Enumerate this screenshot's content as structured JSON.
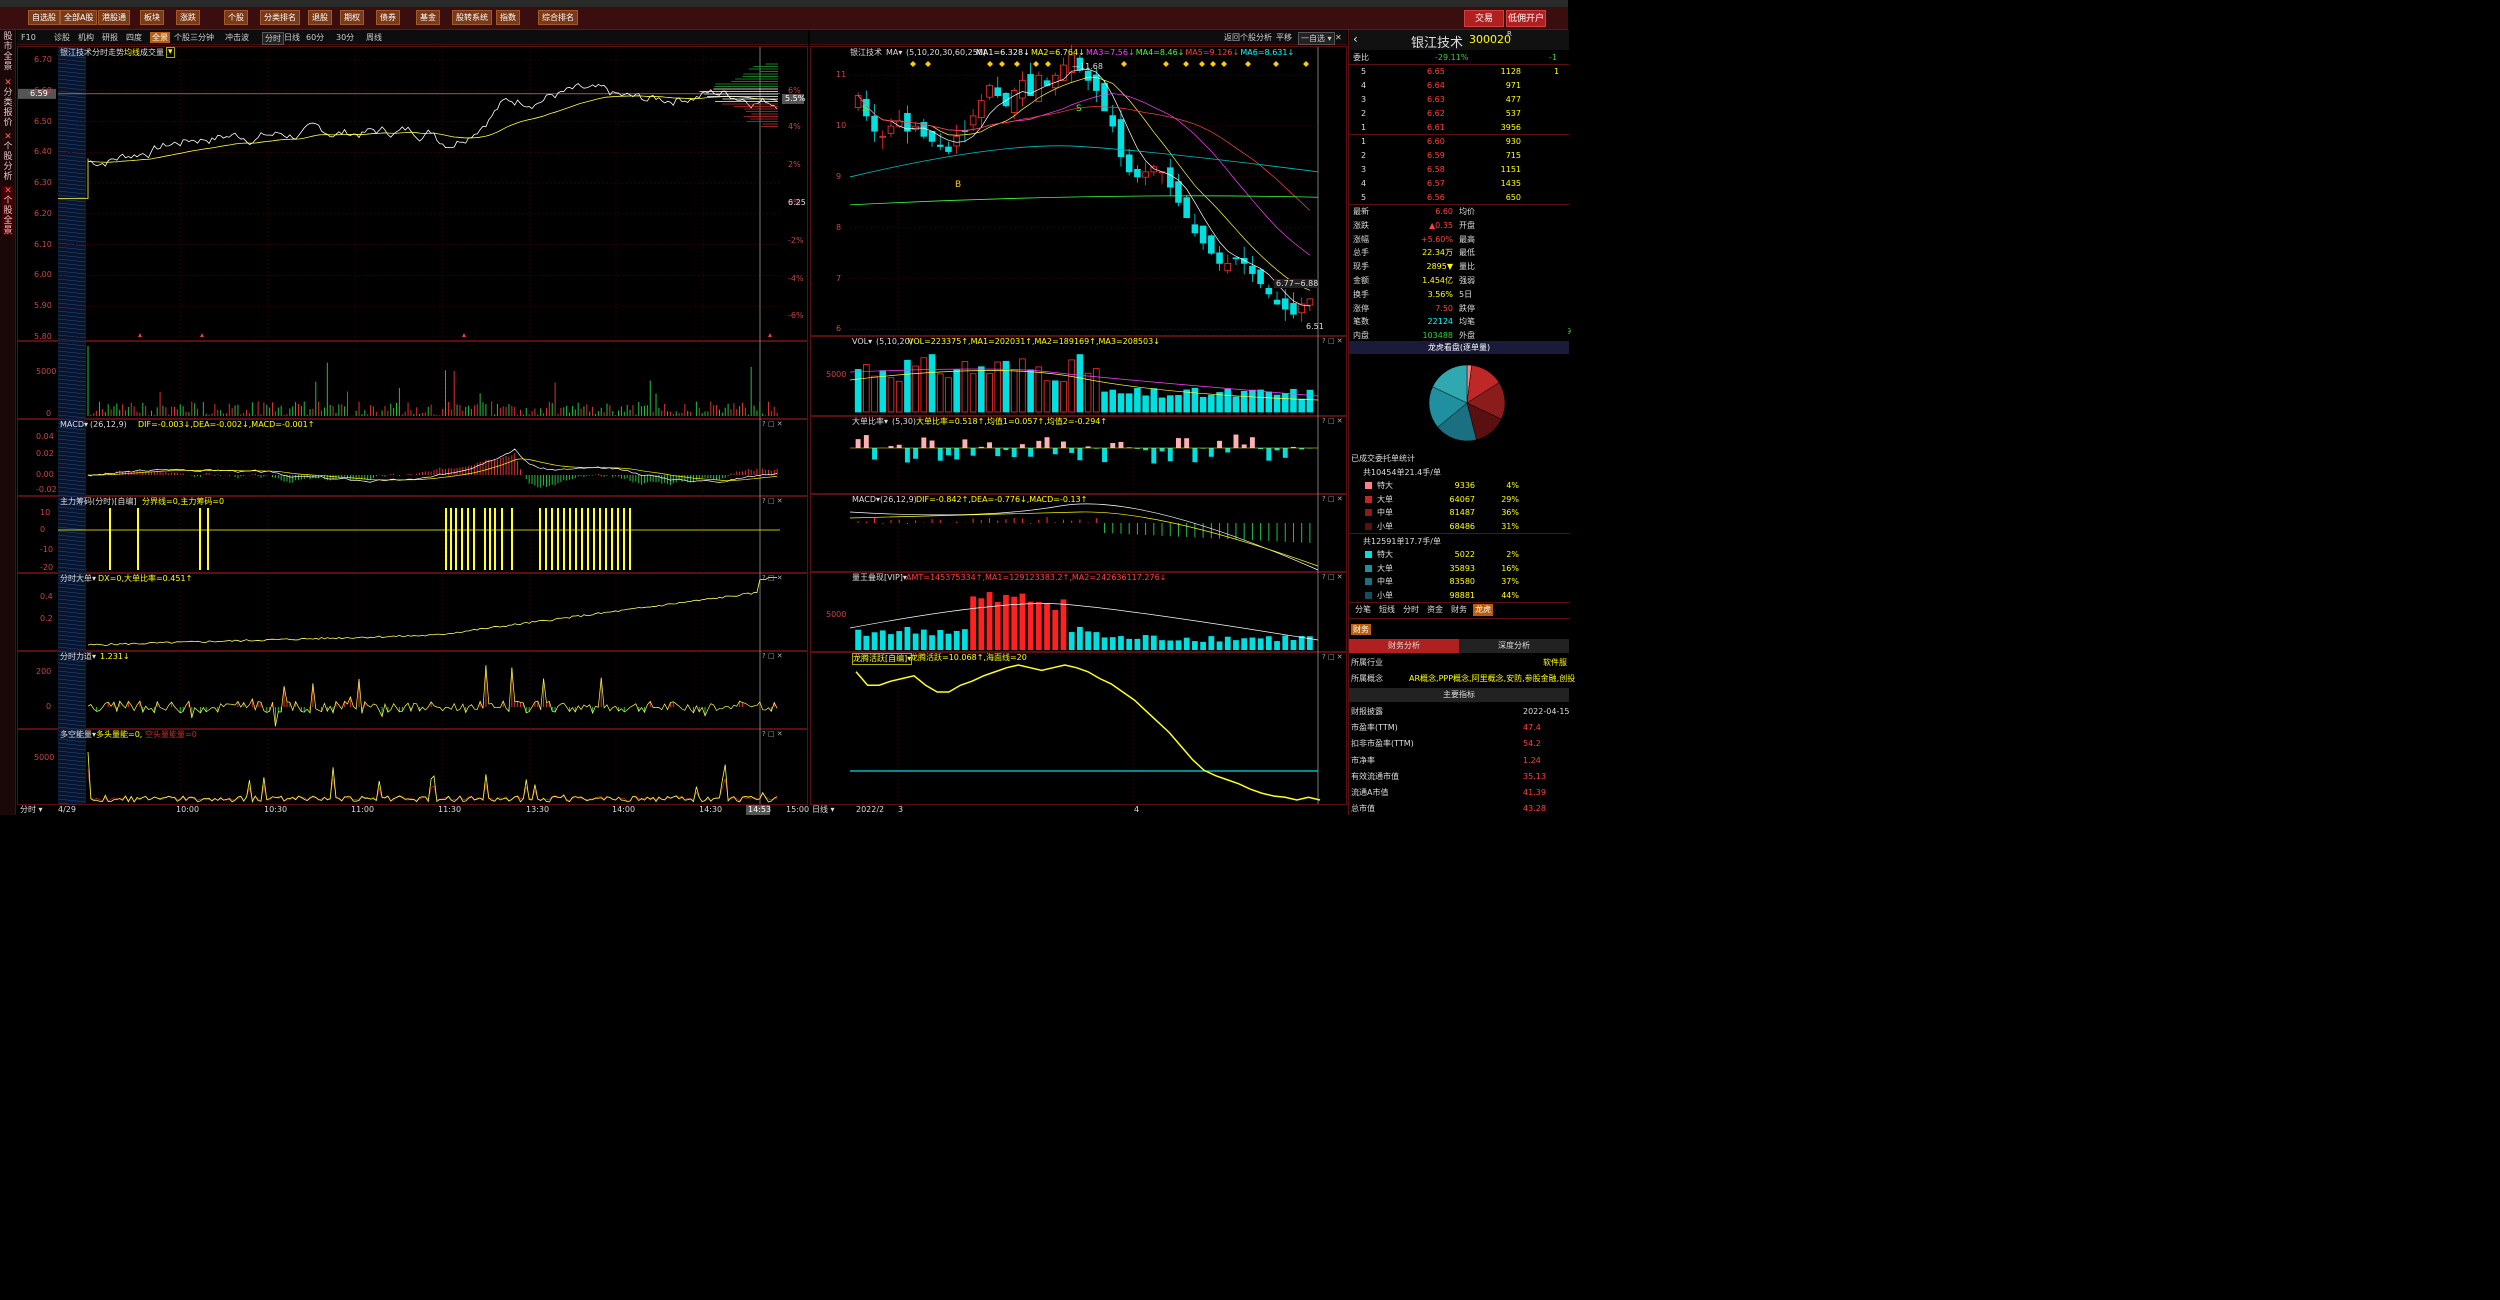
{
  "menu": {
    "items": [
      "自选股",
      "全部A股",
      "港股通",
      "板块",
      "涨跌",
      "个股",
      "分类排名",
      "退股",
      "期权",
      "债券",
      "基金",
      "股转系统",
      "指数",
      "综合排名"
    ],
    "trade_btn": "交易",
    "open_btn": "低佣开户"
  },
  "left_nav": [
    "股市全景",
    "分类报价",
    "个股分析",
    "个股全景"
  ],
  "left_toolbar": {
    "items": [
      "F10",
      "诊股",
      "机构",
      "研报",
      "四度",
      "全景",
      "个股三分钟",
      "冲击波"
    ],
    "modes": [
      "分时",
      "日线",
      "60分",
      "30分",
      "周线"
    ]
  },
  "right_toolbar": {
    "back": "返回个股分析",
    "flat": "平移",
    "zixuan": "一自选"
  },
  "intraday": {
    "title": "银江技术",
    "sub": "分时走势",
    "avg_label": "均线",
    "vol_label": "成交量",
    "price_ticks": [
      "6.70",
      "6.60",
      "6.59",
      "6.50",
      "6.40",
      "6.30",
      "6.20",
      "6.10",
      "6.00",
      "5.90",
      "5.80"
    ],
    "pct_ticks": [
      "6%",
      "5.5%",
      "4%",
      "2%",
      "0%",
      "-2%",
      "-4%",
      "-6%"
    ],
    "mid_label": "6.25",
    "vol_tick": "5000",
    "vol_zero": "0",
    "macd_title": "MACD",
    "macd_params": "(26,12,9)",
    "macd_vals": "DIF=-0.003↓,DEA=-0.002↓,MACD=-0.001↑",
    "macd_ticks": [
      "0.04",
      "0.02",
      "0.00",
      "-0.02"
    ],
    "zlcm_title": "主力筹码(分时)[自编]",
    "zlcm_vals": "分界线=0,主力筹码=0",
    "zlcm_ticks": [
      "10",
      "0",
      "-10",
      "-20"
    ],
    "fsdd_title": "分时大单",
    "fsdd_vals": "DX=0,大单比率=0.451↑",
    "fsdd_ticks": [
      "0.4",
      "0.2"
    ],
    "fsld_title": "分时力道",
    "fsld_vals": "1.231↓",
    "fsld_ticks": [
      "200",
      "0"
    ],
    "dkn_title": "多空能量",
    "dkn_vals": "多头量能=0,",
    "dkn_red": "空头量能量=0",
    "dkn_ticks": [
      "5000"
    ],
    "time_ticks": [
      "4/29",
      "10:00",
      "10:30",
      "11:00",
      "11:30",
      "13:30",
      "14:00",
      "14:30",
      "14:53",
      "15:00"
    ],
    "corner": "分时"
  },
  "daily": {
    "title": "银江技术",
    "ma_label": "MA",
    "ma_params": "(5,10,20,30,60,250)",
    "ma_vals": [
      {
        "t": "MA1=6.328↓",
        "c": "#ffffff"
      },
      {
        "t": "MA2=6.764↓",
        "c": "#ffff00"
      },
      {
        "t": "MA3=7.56↓",
        "c": "#ff40ff"
      },
      {
        "t": "MA4=8.46↓",
        "c": "#40ff40"
      },
      {
        "t": "MA5=9.126↓",
        "c": "#ff4040"
      },
      {
        "t": "MA6=8.631↓",
        "c": "#00ffff"
      }
    ],
    "price_ticks": [
      "11",
      "10",
      "9",
      "8",
      "7",
      "6"
    ],
    "hi_label": "11.68",
    "lo_label": "6.51",
    "range_label": "6.77~6.88",
    "vol_title": "VOL",
    "vol_params": "(5,10,20)",
    "vol_vals": "VOL=223375↑,MA1=202031↑,MA2=189169↑,MA3=208503↓",
    "vol_tick": "5000",
    "ddbl_title": "大单比率",
    "ddbl_params": "(5,30)",
    "ddbl_vals": "大单比率=0.518↑,均值1=0.057↑,均值2=-0.294↑",
    "macd_title": "MACD",
    "macd_params": "(26,12,9)",
    "macd_vals": "DIF=-0.842↑,DEA=-0.776↓,MACD=-0.13↑",
    "amt_title": "量王叠现[VIP]",
    "amt_vals": "AMT=145375334↑,MA1=129123383.2↑,MA2=242636117.276↓",
    "amt_tick": "5000",
    "lthy_title": "龙腾活跃[自编]",
    "lthy_vals": "龙腾活跃=10.068↑,海面线=20",
    "date_ticks": [
      "2022/2",
      "3",
      "4"
    ],
    "corner": "日线"
  },
  "quote": {
    "name": "银江技术",
    "code": "300020",
    "suffix": "R",
    "weibi_label": "委比",
    "weibi": "-29.11%",
    "weibi_num": "-1",
    "sell": [
      {
        "n": "5",
        "p": "6.65",
        "v": "1128",
        "x": "1"
      },
      {
        "n": "4",
        "p": "6.64",
        "v": "971",
        "x": ""
      },
      {
        "n": "3",
        "p": "6.63",
        "v": "477",
        "x": ""
      },
      {
        "n": "2",
        "p": "6.62",
        "v": "537",
        "x": ""
      },
      {
        "n": "1",
        "p": "6.61",
        "v": "3956",
        "x": ""
      }
    ],
    "buy": [
      {
        "n": "1",
        "p": "6.60",
        "v": "930",
        "x": ""
      },
      {
        "n": "2",
        "p": "6.59",
        "v": "715",
        "x": ""
      },
      {
        "n": "3",
        "p": "6.58",
        "v": "1151",
        "x": ""
      },
      {
        "n": "4",
        "p": "6.57",
        "v": "1435",
        "x": ""
      },
      {
        "n": "5",
        "p": "6.56",
        "v": "650",
        "x": ""
      }
    ],
    "sell_side": [
      "委",
      "卖",
      "单"
    ],
    "buy_side": [
      "委",
      "买",
      "单"
    ],
    "stats": [
      {
        "l": "最新",
        "v": "6.60",
        "l2": "均价",
        "c": "red"
      },
      {
        "l": "涨跌",
        "v": "▲0.35",
        "l2": "开盘",
        "c": "red"
      },
      {
        "l": "涨幅",
        "v": "+5.60%",
        "l2": "最高",
        "c": "red"
      },
      {
        "l": "总手",
        "v": "22.34万",
        "l2": "最低",
        "c": "yel"
      },
      {
        "l": "现手",
        "v": "2895▼",
        "l2": "量比",
        "c": "yel"
      },
      {
        "l": "金额",
        "v": "1.454亿",
        "l2": "强弱",
        "c": "yel"
      },
      {
        "l": "换手",
        "v": "3.56%",
        "l2": "5日",
        "c": "yel"
      },
      {
        "l": "涨停",
        "v": "7.50",
        "l2": "跌停",
        "c": "red"
      },
      {
        "l": "笔数",
        "v": "22124",
        "l2": "均笔",
        "c": "cyn"
      },
      {
        "l": "内盘",
        "v": "103488",
        "l2": "外盘",
        "c": "grn"
      }
    ],
    "wuri_extra": "16.",
    "yinp_extra": "119",
    "arrow_extra": "▲",
    "pie_title": "龙虎看盘(逐单量)",
    "pie": [
      {
        "v": 4,
        "c": "#ff6060"
      },
      {
        "v": 29,
        "c": "#c03030"
      },
      {
        "v": 36,
        "c": "#802020"
      },
      {
        "v": 31,
        "c": "#2090a0"
      }
    ],
    "tuoding_title": "已成交委托单统计",
    "buy_total": "共10454单21.4手/单",
    "buy_rows": [
      {
        "k": "特大",
        "v": "9336",
        "p": "4%"
      },
      {
        "k": "大单",
        "v": "64067",
        "p": "29%"
      },
      {
        "k": "中单",
        "v": "81487",
        "p": "36%"
      },
      {
        "k": "小单",
        "v": "68486",
        "p": "31%"
      }
    ],
    "sell_total": "共12591单17.7手/单",
    "sell_rows": [
      {
        "k": "特大",
        "v": "5022",
        "p": "2%"
      },
      {
        "k": "大单",
        "v": "35893",
        "p": "16%"
      },
      {
        "k": "中单",
        "v": "83580",
        "p": "37%"
      },
      {
        "k": "小单",
        "v": "98881",
        "p": "44%"
      }
    ],
    "tabs": [
      "分笔",
      "短线",
      "分时",
      "资金",
      "财务",
      "龙虎"
    ],
    "cw_tab": "财务",
    "fin_tabs": [
      "财务分析",
      "深度分析"
    ],
    "industry_label": "所属行业",
    "industry": "软件服",
    "concept_label": "所属概念",
    "concept": "AR概念,PPP概念,阿里概念,安防,参股金融,创投",
    "main_idx": "主要指标",
    "fin": [
      {
        "l": "财报披露",
        "v": "2022-04-15",
        "c": "wht"
      },
      {
        "l": "市盈率(TTM)",
        "v": "47.4",
        "c": "red"
      },
      {
        "l": "扣非市盈率(TTM)",
        "v": "54.2",
        "c": "red"
      },
      {
        "l": "市净率",
        "v": "1.24",
        "c": "red"
      },
      {
        "l": "有效流通市值",
        "v": "35.13",
        "c": "red"
      },
      {
        "l": "流通A市值",
        "v": "41.39",
        "c": "red"
      },
      {
        "l": "总市值",
        "v": "43.28",
        "c": "red"
      }
    ]
  }
}
